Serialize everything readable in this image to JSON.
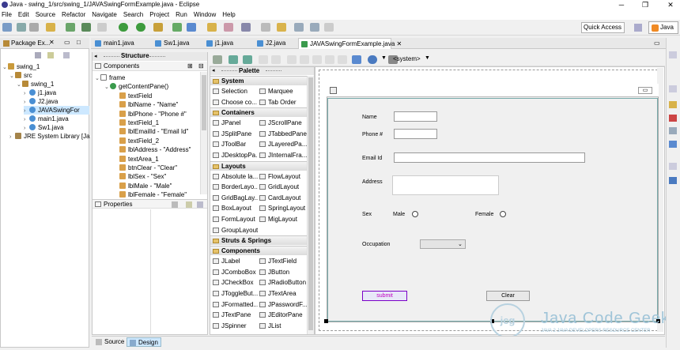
{
  "window": {
    "title": "Java - swing_1/src/swing_1/JAVASwingFormExample.java - Eclipse"
  },
  "menu": [
    "File",
    "Edit",
    "Source",
    "Refactor",
    "Navigate",
    "Search",
    "Project",
    "Run",
    "Window",
    "Help"
  ],
  "toolbar": {
    "quick_access": "Quick Access",
    "perspective": "Java"
  },
  "package_explorer": {
    "tab": "Package Ex...",
    "tree": [
      {
        "label": "swing_1",
        "level": 0,
        "icon": "project-icon",
        "twisty": "open"
      },
      {
        "label": "src",
        "level": 1,
        "icon": "source-folder-icon",
        "twisty": "open"
      },
      {
        "label": "swing_1",
        "level": 2,
        "icon": "package-icon",
        "twisty": "open"
      },
      {
        "label": "j1.java",
        "level": 3,
        "icon": "java-file-icon",
        "twisty": "closed"
      },
      {
        "label": "J2.java",
        "level": 3,
        "icon": "java-file-icon",
        "twisty": "closed"
      },
      {
        "label": "JAVASwingFor",
        "level": 3,
        "icon": "java-file-icon",
        "twisty": "closed",
        "selected": true
      },
      {
        "label": "main1.java",
        "level": 3,
        "icon": "java-file-icon",
        "twisty": "closed"
      },
      {
        "label": "Sw1.java",
        "level": 3,
        "icon": "java-file-icon",
        "twisty": "closed"
      },
      {
        "label": "JRE System Library [Ja",
        "level": 1,
        "icon": "library-icon",
        "twisty": "closed"
      }
    ]
  },
  "editor_tabs": [
    {
      "label": "main1.java"
    },
    {
      "label": "Sw1.java"
    },
    {
      "label": "j1.java"
    },
    {
      "label": "J2.java"
    },
    {
      "label": "JAVASwingFormExample.java",
      "active": true
    }
  ],
  "structure": {
    "title": "Structure",
    "components_label": "Components",
    "tree": [
      {
        "label": "frame",
        "level": 0
      },
      {
        "label": "getContentPane()",
        "level": 1
      },
      {
        "label": "textField",
        "level": 2
      },
      {
        "label": "lblName - \"Name\"",
        "level": 2
      },
      {
        "label": "lblPhone - \"Phone #\"",
        "level": 2
      },
      {
        "label": "textField_1",
        "level": 2
      },
      {
        "label": "lblEmailId - \"Email Id\"",
        "level": 2
      },
      {
        "label": "textField_2",
        "level": 2
      },
      {
        "label": "lblAddress - \"Address\"",
        "level": 2
      },
      {
        "label": "textArea_1",
        "level": 2
      },
      {
        "label": "btnClear - \"Clear\"",
        "level": 2
      },
      {
        "label": "lblSex - \"Sex\"",
        "level": 2
      },
      {
        "label": "lblMale - \"Male\"",
        "level": 2
      },
      {
        "label": "lblFemale - \"Female\"",
        "level": 2
      }
    ],
    "properties_label": "Properties"
  },
  "palette": {
    "title": "Palette",
    "system_label": "<system>",
    "categories": [
      {
        "name": "System",
        "items": [
          "Selection",
          "Marquee",
          "Choose co...",
          "Tab Order"
        ]
      },
      {
        "name": "Containers",
        "items": [
          "JPanel",
          "JScrollPane",
          "JSplitPane",
          "JTabbedPane",
          "JToolBar",
          "JLayeredPa...",
          "JDesktopPa...",
          "JInternalFra..."
        ]
      },
      {
        "name": "Layouts",
        "items": [
          "Absolute la...",
          "FlowLayout",
          "BorderLayo...",
          "GridLayout",
          "GridBagLay...",
          "CardLayout",
          "BoxLayout",
          "SpringLayout",
          "FormLayout",
          "MigLayout",
          "GroupLayout"
        ]
      },
      {
        "name": "Struts & Springs",
        "items": []
      },
      {
        "name": "Components",
        "items": [
          "JLabel",
          "JTextField",
          "JComboBox",
          "JButton",
          "JCheckBox",
          "JRadioButton",
          "JToggleBut...",
          "JTextArea",
          "JFormatted...",
          "JPasswordF...",
          "JTextPane",
          "JEditorPane",
          "JSpinner",
          "JList"
        ]
      }
    ]
  },
  "form": {
    "name_label": "Name",
    "phone_label": "Phone #",
    "email_label": "Email Id",
    "address_label": "Address",
    "sex_label": "Sex",
    "male_label": "Male",
    "female_label": "Female",
    "occupation_label": "Occupation",
    "submit_label": "submit",
    "clear_label": "Clear"
  },
  "bottom_tabs": {
    "source": "Source",
    "design": "Design"
  },
  "watermark": {
    "brand": "Java Code Geeks",
    "tagline": "JAVA 2 JAVA DEVELOPERS RESOURCE CENTER"
  },
  "colors": {
    "selection": "#cde8ff",
    "submit_border": "#7a00c8",
    "submit_text": "#c000c0",
    "watermark": "#9fc4d8"
  }
}
